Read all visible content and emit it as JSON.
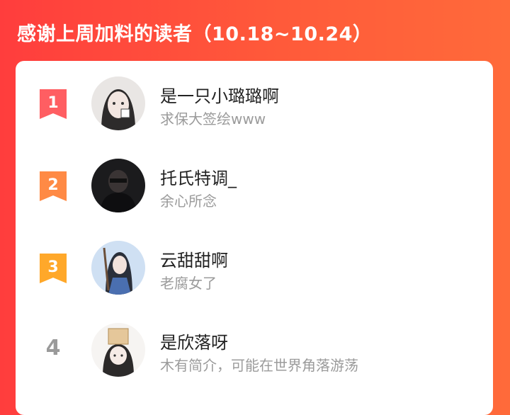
{
  "header": {
    "title": "感谢上周加料的读者（10.18~10.24）"
  },
  "colors": {
    "rank1": "#ff5e62",
    "rank2": "#ff8a45",
    "rank3": "#ffa82a",
    "rank_plain": "#9a9a9a",
    "name_text": "#222222",
    "desc_text": "#9b9b9b"
  },
  "readers": [
    {
      "rank": "1",
      "name": "是一只小璐璐啊",
      "desc": "求保大签绘www",
      "avatar_icon": "avatar-girl-light"
    },
    {
      "rank": "2",
      "name": "托氏特调_",
      "desc": "余心所念",
      "avatar_icon": "avatar-dark-figure"
    },
    {
      "rank": "3",
      "name": "云甜甜啊",
      "desc": "老腐女了",
      "avatar_icon": "avatar-girl-blue"
    },
    {
      "rank": "4",
      "name": "是欣落呀",
      "desc": "木有简介，可能在世界角落游荡",
      "avatar_icon": "avatar-box-head"
    }
  ]
}
